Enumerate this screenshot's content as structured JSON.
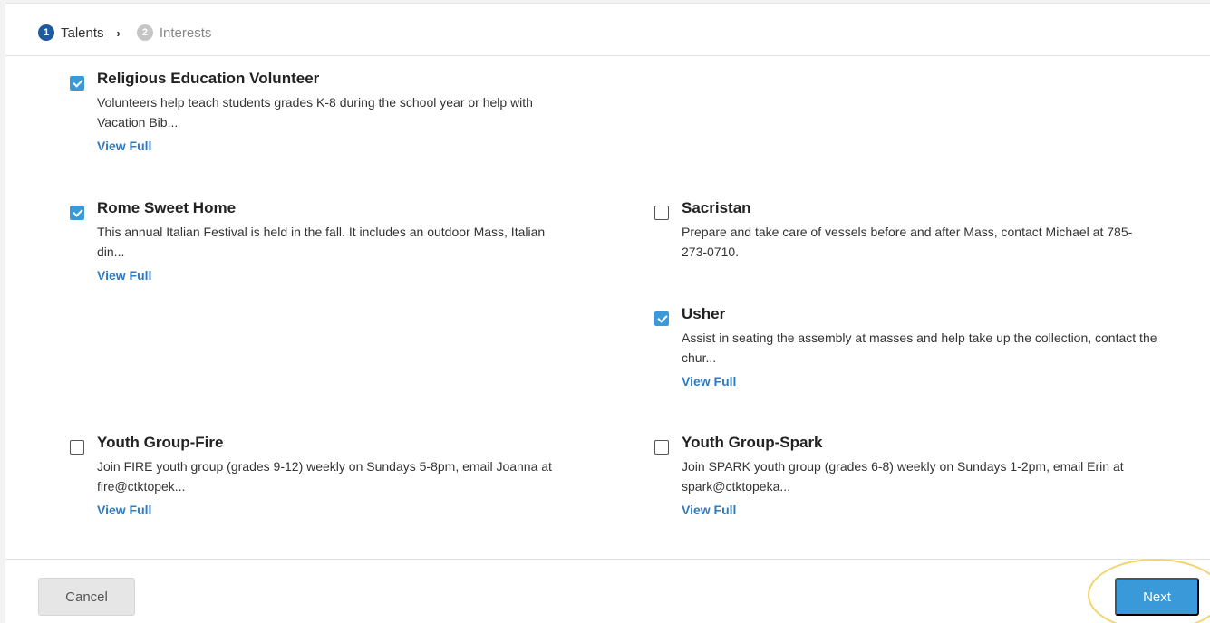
{
  "stepper": {
    "steps": [
      {
        "number": "1",
        "label": "Talents"
      },
      {
        "number": "2",
        "label": "Interests"
      }
    ],
    "separator": "›"
  },
  "items": [
    {
      "title": "Religious Education Volunteer",
      "checked": true,
      "desc_lines": [
        "Volunteers help teach students grades K-8 during the school year or help with",
        "Vacation Bib..."
      ],
      "link": "View Full"
    },
    {
      "title": "Rome Sweet Home",
      "checked": true,
      "desc_lines": [
        "This annual Italian Festival is held in the fall. It includes an outdoor Mass, Italian",
        "din..."
      ],
      "link": "View Full"
    },
    {
      "title": "Sacristan",
      "checked": false,
      "desc_lines": [
        "Prepare and take care of vessels before and after Mass, contact Michael at 785-",
        "273-0710."
      ],
      "link": ""
    },
    {
      "title": "Usher",
      "checked": true,
      "desc_lines": [
        "Assist in seating the assembly at masses and help take up the collection, contact the",
        "chur..."
      ],
      "link": "View Full"
    },
    {
      "title": "Youth Group-Fire",
      "checked": false,
      "desc_lines": [
        "Join FIRE youth group (grades 9-12) weekly on Sundays 5-8pm, email Joanna at",
        "fire@ctktopek..."
      ],
      "link": "View Full"
    },
    {
      "title": "Youth Group-Spark",
      "checked": false,
      "desc_lines": [
        "Join SPARK youth group (grades 6-8) weekly on Sundays 1-2pm, email Erin at",
        "spark@ctktopeka..."
      ],
      "link": "View Full"
    }
  ],
  "footer": {
    "cancel_label": "Cancel",
    "next_label": "Next"
  },
  "colors": {
    "accent": "#3a9ad9",
    "step_active": "#1f5a9f",
    "link": "#2f7bbf",
    "highlight": "#f4d36b"
  }
}
